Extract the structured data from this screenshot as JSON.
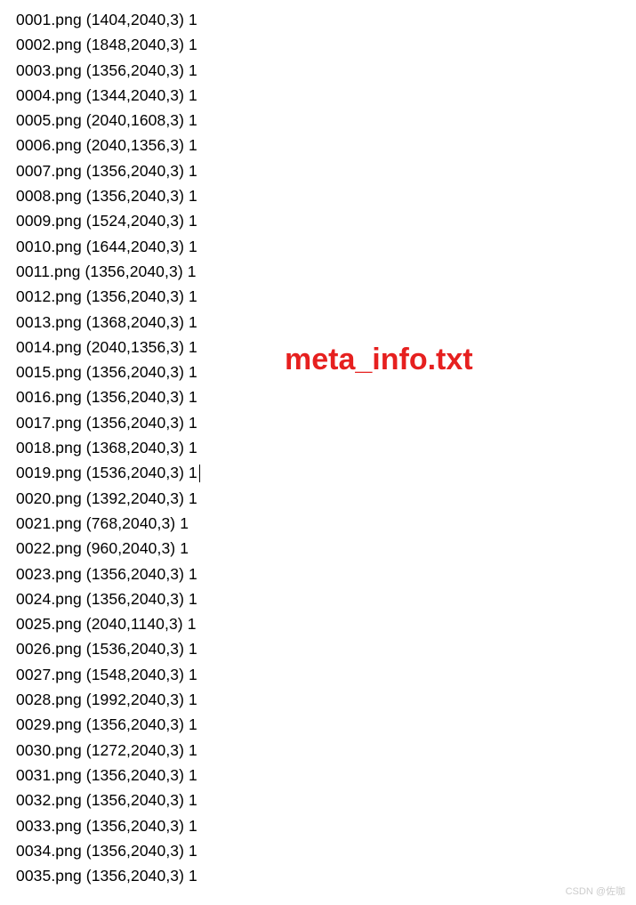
{
  "file_entries": [
    {
      "filename": "0001.png",
      "dims": "(1404,2040,3)",
      "flag": "1"
    },
    {
      "filename": "0002.png",
      "dims": "(1848,2040,3)",
      "flag": "1"
    },
    {
      "filename": "0003.png",
      "dims": "(1356,2040,3)",
      "flag": "1"
    },
    {
      "filename": "0004.png",
      "dims": "(1344,2040,3)",
      "flag": "1"
    },
    {
      "filename": "0005.png",
      "dims": "(2040,1608,3)",
      "flag": "1"
    },
    {
      "filename": "0006.png",
      "dims": "(2040,1356,3)",
      "flag": "1"
    },
    {
      "filename": "0007.png",
      "dims": "(1356,2040,3)",
      "flag": "1"
    },
    {
      "filename": "0008.png",
      "dims": "(1356,2040,3)",
      "flag": "1"
    },
    {
      "filename": "0009.png",
      "dims": "(1524,2040,3)",
      "flag": "1"
    },
    {
      "filename": "0010.png",
      "dims": "(1644,2040,3)",
      "flag": "1"
    },
    {
      "filename": "0011.png",
      "dims": "(1356,2040,3)",
      "flag": "1"
    },
    {
      "filename": "0012.png",
      "dims": "(1356,2040,3)",
      "flag": "1"
    },
    {
      "filename": "0013.png",
      "dims": "(1368,2040,3)",
      "flag": "1"
    },
    {
      "filename": "0014.png",
      "dims": "(2040,1356,3)",
      "flag": "1"
    },
    {
      "filename": "0015.png",
      "dims": "(1356,2040,3)",
      "flag": "1"
    },
    {
      "filename": "0016.png",
      "dims": "(1356,2040,3)",
      "flag": "1"
    },
    {
      "filename": "0017.png",
      "dims": "(1356,2040,3)",
      "flag": "1"
    },
    {
      "filename": "0018.png",
      "dims": "(1368,2040,3)",
      "flag": "1"
    },
    {
      "filename": "0019.png",
      "dims": "(1536,2040,3)",
      "flag": "1",
      "has_cursor": true
    },
    {
      "filename": "0020.png",
      "dims": "(1392,2040,3)",
      "flag": "1"
    },
    {
      "filename": "0021.png",
      "dims": "(768,2040,3)",
      "flag": "1"
    },
    {
      "filename": "0022.png",
      "dims": "(960,2040,3)",
      "flag": "1"
    },
    {
      "filename": "0023.png",
      "dims": "(1356,2040,3)",
      "flag": "1"
    },
    {
      "filename": "0024.png",
      "dims": "(1356,2040,3)",
      "flag": "1"
    },
    {
      "filename": "0025.png",
      "dims": "(2040,1140,3)",
      "flag": "1"
    },
    {
      "filename": "0026.png",
      "dims": "(1536,2040,3)",
      "flag": "1"
    },
    {
      "filename": "0027.png",
      "dims": "(1548,2040,3)",
      "flag": "1"
    },
    {
      "filename": "0028.png",
      "dims": "(1992,2040,3)",
      "flag": "1"
    },
    {
      "filename": "0029.png",
      "dims": "(1356,2040,3)",
      "flag": "1"
    },
    {
      "filename": "0030.png",
      "dims": "(1272,2040,3)",
      "flag": "1"
    },
    {
      "filename": "0031.png",
      "dims": "(1356,2040,3)",
      "flag": "1"
    },
    {
      "filename": "0032.png",
      "dims": "(1356,2040,3)",
      "flag": "1"
    },
    {
      "filename": "0033.png",
      "dims": "(1356,2040,3)",
      "flag": "1"
    },
    {
      "filename": "0034.png",
      "dims": "(1356,2040,3)",
      "flag": "1"
    },
    {
      "filename": "0035.png",
      "dims": "(1356,2040,3)",
      "flag": "1"
    }
  ],
  "annotation": {
    "label": "meta_info.txt"
  },
  "watermark": {
    "text": "CSDN @佐咖"
  }
}
